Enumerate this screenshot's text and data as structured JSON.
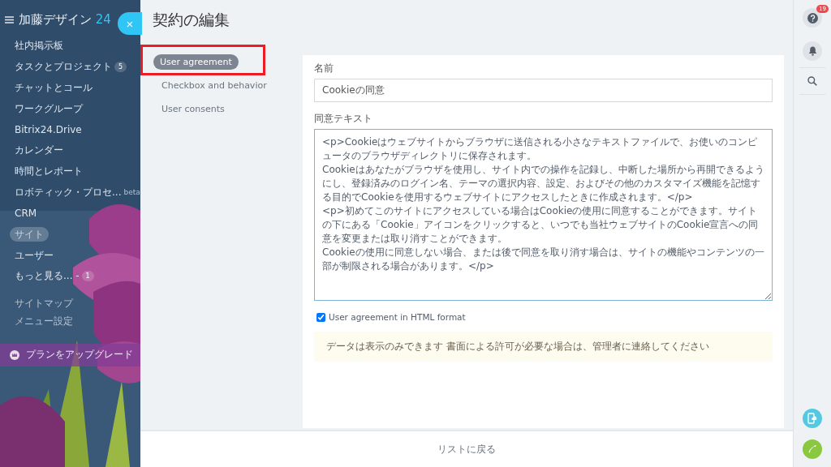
{
  "sidebar": {
    "logo": "加藤デザイン",
    "logo_suffix": "24",
    "close": "×",
    "items": [
      {
        "label": "社内掲示板",
        "selected": false
      },
      {
        "label": "タスクとプロジェクト",
        "counter": "5",
        "selected": false
      },
      {
        "label": "チャットとコール",
        "selected": false
      },
      {
        "label": "ワークグループ",
        "selected": false
      },
      {
        "label": "Bitrix24.Drive",
        "selected": false
      },
      {
        "label": "カレンダー",
        "selected": false
      },
      {
        "label": "時間とレポート",
        "selected": false
      },
      {
        "label": "ロボティック・プロセ...",
        "tag": "beta",
        "selected": false
      },
      {
        "label": "CRM",
        "selected": false
      },
      {
        "label": "サイト",
        "selected": true
      },
      {
        "label": "ユーザー",
        "selected": false
      },
      {
        "label": "もっと見る... -",
        "counter": "1",
        "selected": false
      }
    ],
    "links": [
      "サイトマップ",
      "メニュー設定"
    ],
    "upgrade": "プランをアップグレード"
  },
  "page": {
    "title": "契約の編集"
  },
  "tabs": [
    {
      "label": "User agreement",
      "selected": true,
      "highlighted": true
    },
    {
      "label": "Checkbox and behavior",
      "selected": false,
      "highlighted": false
    },
    {
      "label": "User consents",
      "selected": false,
      "highlighted": false
    }
  ],
  "form": {
    "name_label": "名前",
    "name_value": "Cookieの同意",
    "text_label": "同意テキスト",
    "text_value": "<p>Cookieはウェブサイトからブラウザに送信される小さなテキストファイルで、お使いのコンピュータのブラウザディレクトリに保存されます。\nCookieはあなたがブラウザを使用し、サイト内での操作を記録し、中断した場所から再開できるようにし、登録済みのログイン名、テーマの選択内容、設定、およびその他のカスタマイズ機能を記憶する目的でCookieを使用するウェブサイトにアクセスしたときに作成されます。</p>\n<p>初めてこのサイトにアクセスしている場合はCookieの使用に同意することができます。サイトの下にある「Cookie」アイコンをクリックすると、いつでも当社ウェブサイトのCookie宣言への同意を変更または取り消すことができます。\nCookieの使用に同意しない場合、または後で同意を取り消す場合は、サイトの機能やコンテンツの一部が制限される場合があります。</p>",
    "html_checkbox": {
      "label": "User agreement in HTML format",
      "checked": true
    },
    "notice": "データは表示のみできます 書面による許可が必要な場合は、管理者に連絡してください"
  },
  "footer": {
    "back": "リストに戻る"
  },
  "right_bar": {
    "help_badge": "19"
  }
}
